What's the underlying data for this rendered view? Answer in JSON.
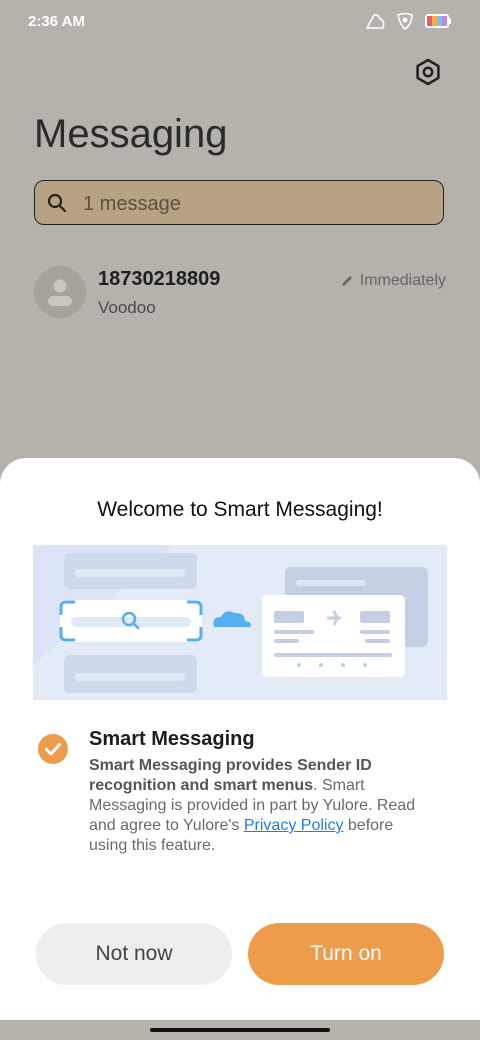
{
  "status": {
    "time": "2:36 AM",
    "icons": [
      "cloud-icon",
      "shield-icon",
      "battery-icon"
    ]
  },
  "header": {
    "title": "Messaging",
    "settings_icon": "gear-icon"
  },
  "search": {
    "placeholder": "1 message"
  },
  "conversation": {
    "sender": "18730218809",
    "snippet": "Voodoo",
    "time": "Immediately"
  },
  "sheet": {
    "title": "Welcome to Smart Messaging!",
    "option_title": "Smart Messaging",
    "desc_bold": "Smart Messaging provides Sender ID recognition and smart menus",
    "desc_rest": ". Smart Messaging is provided in part by Yulore. Read and agree to Yulore's ",
    "privacy_link": "Privacy Policy",
    "desc_end": " before using this feature.",
    "not_now": "Not now",
    "turn_on": "Turn on"
  },
  "colors": {
    "accent": "#ef9b4c",
    "link": "#1f7fe6",
    "dim_bg": "#b5b2ab"
  }
}
